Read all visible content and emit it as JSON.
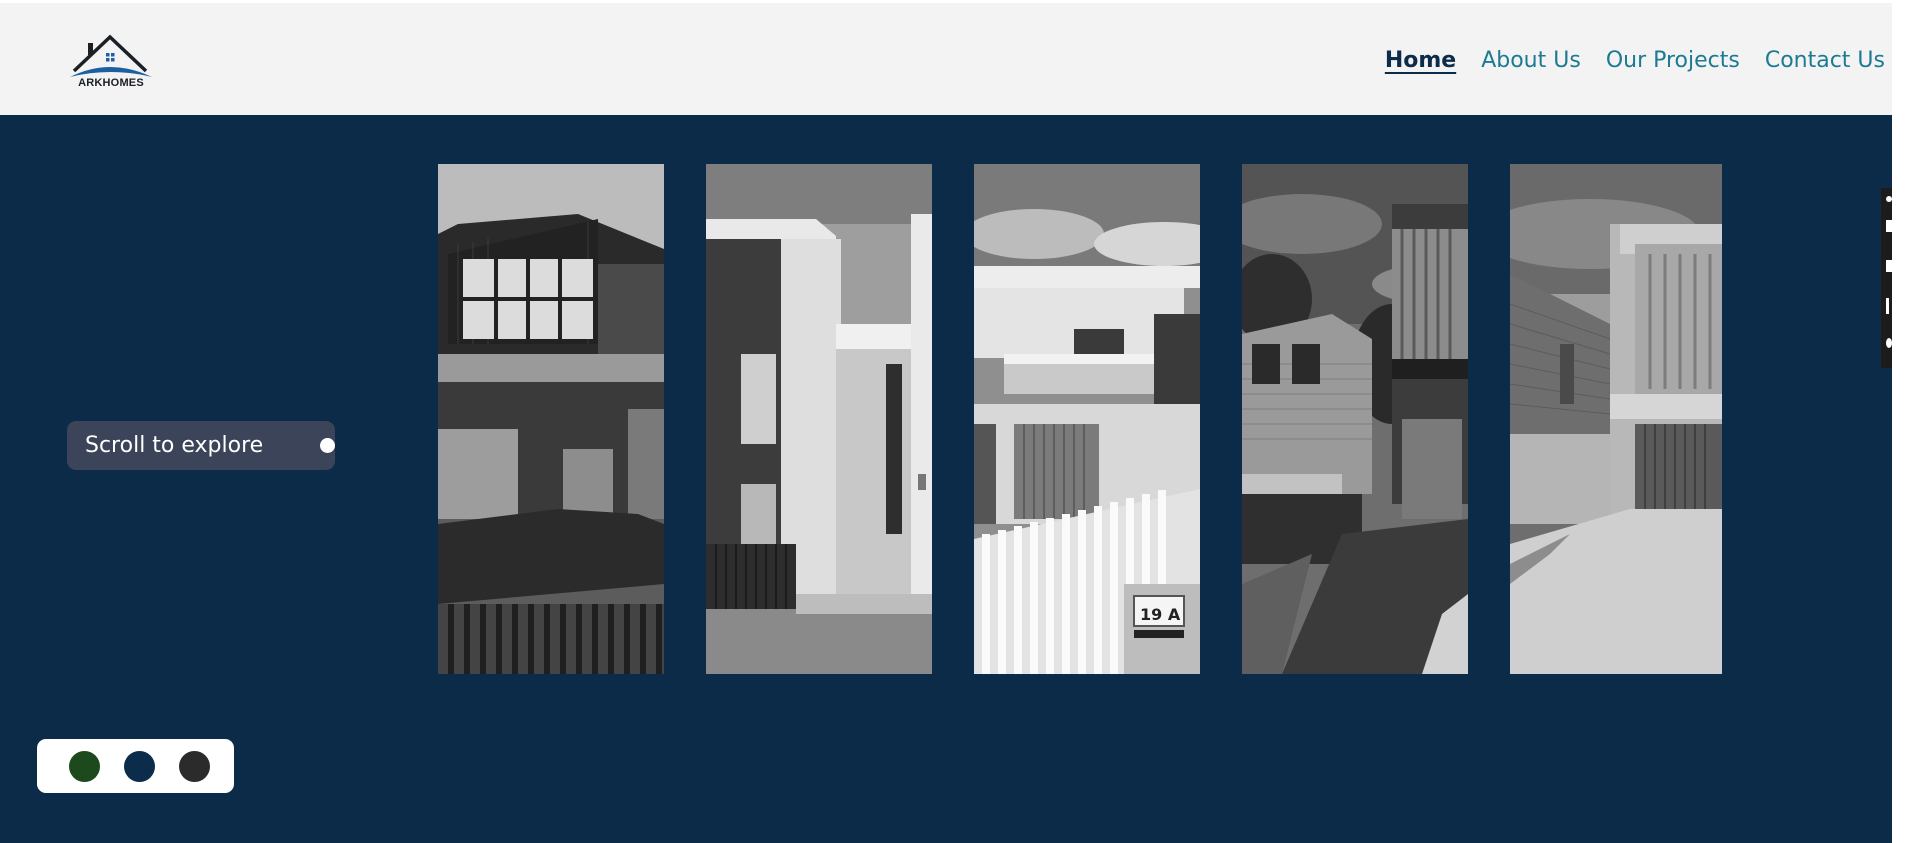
{
  "brand": {
    "name": "ARKHOMES",
    "colors": {
      "primary_navy": "#0b2b49",
      "accent_blue": "#1d5fa3",
      "link_teal": "#1c7a93",
      "header_bg": "#f3f3f3",
      "pill_bg": "#3b4458"
    }
  },
  "nav": {
    "items": [
      {
        "label": "Home",
        "active": true
      },
      {
        "label": "About Us",
        "active": false
      },
      {
        "label": "Our Projects",
        "active": false
      },
      {
        "label": "Contact Us",
        "active": false
      }
    ]
  },
  "hero": {
    "scroll_hint": "Scroll to explore",
    "gallery": [
      {
        "name": "house-photo-1",
        "icon": "house-photo"
      },
      {
        "name": "house-photo-2",
        "icon": "house-photo"
      },
      {
        "name": "house-photo-3",
        "house_number": "19 A",
        "icon": "house-photo"
      },
      {
        "name": "house-photo-4",
        "icon": "house-photo"
      },
      {
        "name": "house-photo-5",
        "icon": "house-photo"
      }
    ]
  },
  "theme_switcher": {
    "swatches": [
      {
        "name": "green",
        "color": "#1c4a1c"
      },
      {
        "name": "navy",
        "color": "#0c2c4b"
      },
      {
        "name": "charcoal",
        "color": "#2b2b2b"
      }
    ]
  },
  "side_toolbar": {
    "icons": [
      "search-icon",
      "square-icon",
      "square-icon",
      "document-icon",
      "gear-icon"
    ]
  }
}
